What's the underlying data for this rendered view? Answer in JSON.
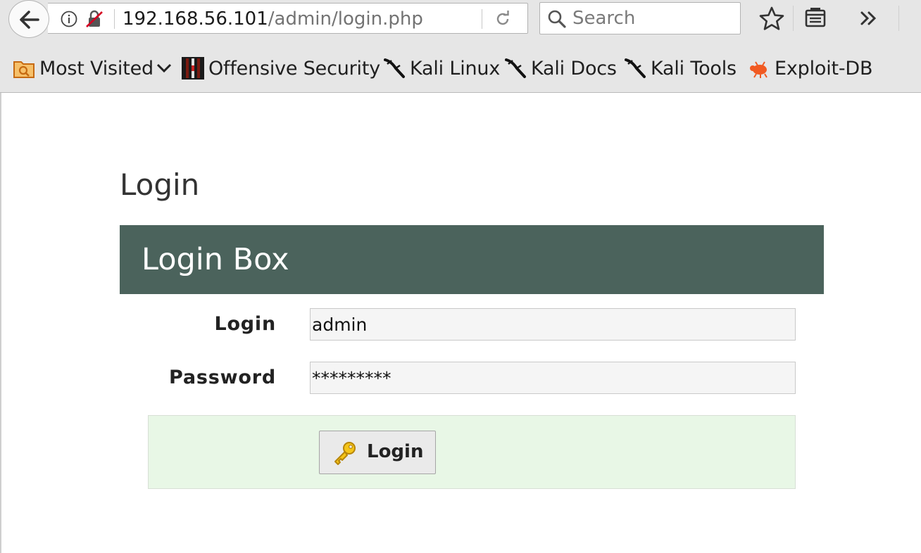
{
  "browser": {
    "url_host": "192.168.56.101",
    "url_path": "/admin/login.php",
    "search_placeholder": "Search",
    "icons": {
      "back": "back-arrow-icon",
      "info": "info-icon",
      "insecure": "insecure-connection-icon",
      "reload": "reload-icon",
      "search": "search-icon",
      "bookmark": "star-icon",
      "library": "library-icon",
      "overflow": "overflow-chevron-icon"
    }
  },
  "bookmarks": [
    {
      "label": "Most Visited",
      "icon": "most-visited-folder-icon"
    },
    {
      "label": "Offensive Security",
      "icon": "offensive-security-icon"
    },
    {
      "label": "Kali Linux",
      "icon": "kali-dragon-icon"
    },
    {
      "label": "Kali Docs",
      "icon": "kali-dragon-icon"
    },
    {
      "label": "Kali Tools",
      "icon": "kali-dragon-icon"
    },
    {
      "label": "Exploit-DB",
      "icon": "exploit-db-bug-icon"
    }
  ],
  "page": {
    "title": "Login",
    "box_title": "Login Box",
    "header_color": "#4b635c",
    "action_bg_color": "#e8f7e6",
    "form": {
      "login_label": "Login",
      "login_value": "admin",
      "password_label": "Password",
      "password_value": "*********",
      "submit_label": "Login",
      "submit_icon": "key-icon"
    }
  }
}
